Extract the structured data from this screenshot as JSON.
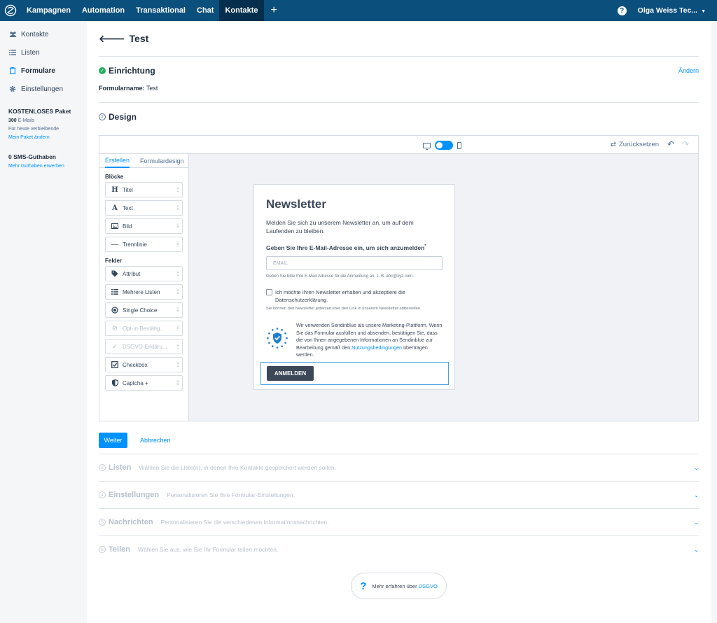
{
  "topnav": {
    "items": [
      "Kampagnen",
      "Automation",
      "Transaktional",
      "Chat",
      "Kontakte"
    ],
    "active": "Kontakte",
    "plus": "+",
    "help": "?",
    "user": "Olga Weiss Tec..."
  },
  "sidebar": {
    "items": [
      {
        "label": "Kontakte",
        "icon": "users-icon"
      },
      {
        "label": "Listen",
        "icon": "list-icon"
      },
      {
        "label": "Formulare",
        "icon": "clipboard-icon",
        "active": true
      },
      {
        "label": "Einstellungen",
        "icon": "gear-icon"
      }
    ],
    "plan": {
      "title": "KOSTENLOSES Paket",
      "emails_count": "300",
      "emails_label": "E-Mails",
      "remaining": "Für heute verbleibende",
      "change_link": "Mein Paket ändern",
      "sms_title": "0 SMS-Guthaben",
      "sms_link": "Mehr Guthaben erwerben"
    }
  },
  "page": {
    "back_title": "Test",
    "setup": {
      "title": "Einrichtung",
      "edit_link": "Ändern",
      "formname_label": "Formularname:",
      "formname_value": "Test"
    },
    "design": {
      "num": "2",
      "title": "Design"
    }
  },
  "editor": {
    "reset_label": "Zurücksetzen",
    "tabs": [
      "Erstellen",
      "Formulardesign"
    ],
    "blocks_label": "Blöcke",
    "blocks": [
      {
        "label": "Titel",
        "icon": "H"
      },
      {
        "label": "Text",
        "icon": "A"
      },
      {
        "label": "Bild",
        "icon": "image-icon"
      },
      {
        "label": "Trennlinie",
        "icon": "divider-icon"
      }
    ],
    "fields_label": "Felder",
    "fields": [
      {
        "label": "Attribut",
        "icon": "tag-icon"
      },
      {
        "label": "Mehrere Listen",
        "icon": "list-icon"
      },
      {
        "label": "Single Choice",
        "icon": "radio-icon"
      },
      {
        "label": "Opt-in-Bestätig...",
        "icon": "link-icon",
        "disabled": true
      },
      {
        "label": "DSGVO-Erkläru...",
        "icon": "check-icon",
        "disabled": true
      },
      {
        "label": "Checkbox",
        "icon": "checkbox-icon"
      },
      {
        "label": "Captcha +",
        "icon": "shield-icon"
      }
    ]
  },
  "form_preview": {
    "title": "Newsletter",
    "description": "Melden Sie sich zu unserem Newsletter an, um auf dem Laufenden zu bleiben.",
    "email_label": "Geben Sie Ihre E-Mail-Adresse ein, um sich anzumelden",
    "required_mark": "*",
    "email_placeholder": "EMAIL",
    "email_help": "Geben Sie bitte Ihre E-Mail-Adresse für die Anmeldung an, z. B. abc@xyz.com.",
    "consent": "Ich möchte Ihren Newsletter erhalten und akzeptiere die Datenschutzerklärung.",
    "unsubscribe_note": "Sie können den Newsletter jederzeit über den Link in unserem Newsletter abbestellen.",
    "gdpr_text": "Wir verwenden Sendinblue als unsere Marketing-Plattform. Wenn Sie das Formular ausfüllen und absenden, bestätigen Sie, dass die von Ihnen angegebenen Informationen an Sendinblue zur Bearbeitung gemäß den",
    "gdpr_link": "Nutzungsbedingungen",
    "gdpr_text_end": "übertragen werden.",
    "submit": "ANMELDEN"
  },
  "actions": {
    "next": "Weiter",
    "cancel": "Abbrechen"
  },
  "steps": [
    {
      "num": "3",
      "title": "Listen",
      "desc": "Wählen Sie die Liste(n), in denen Ihre Kontakte gespeichert werden sollen."
    },
    {
      "num": "4",
      "title": "Einstellungen",
      "desc": "Personalisieren Sie Ihre Formular-Einstellungen."
    },
    {
      "num": "5",
      "title": "Nachrichten",
      "desc": "Personalisieren Sie die verschiedenen Informationsnachrichten."
    },
    {
      "num": "6",
      "title": "Teilen",
      "desc": "Wählen Sie aus, wie Sie Ihr Formular teilen möchten."
    }
  ],
  "gdpr_pill": {
    "icon": "?",
    "text": "Mehr erfahren über",
    "link": "DSGVO"
  },
  "colors": {
    "topbar": "#0b4f7c",
    "accent": "#0092ff",
    "success": "#27ae60",
    "button_dark": "#3c4858"
  }
}
